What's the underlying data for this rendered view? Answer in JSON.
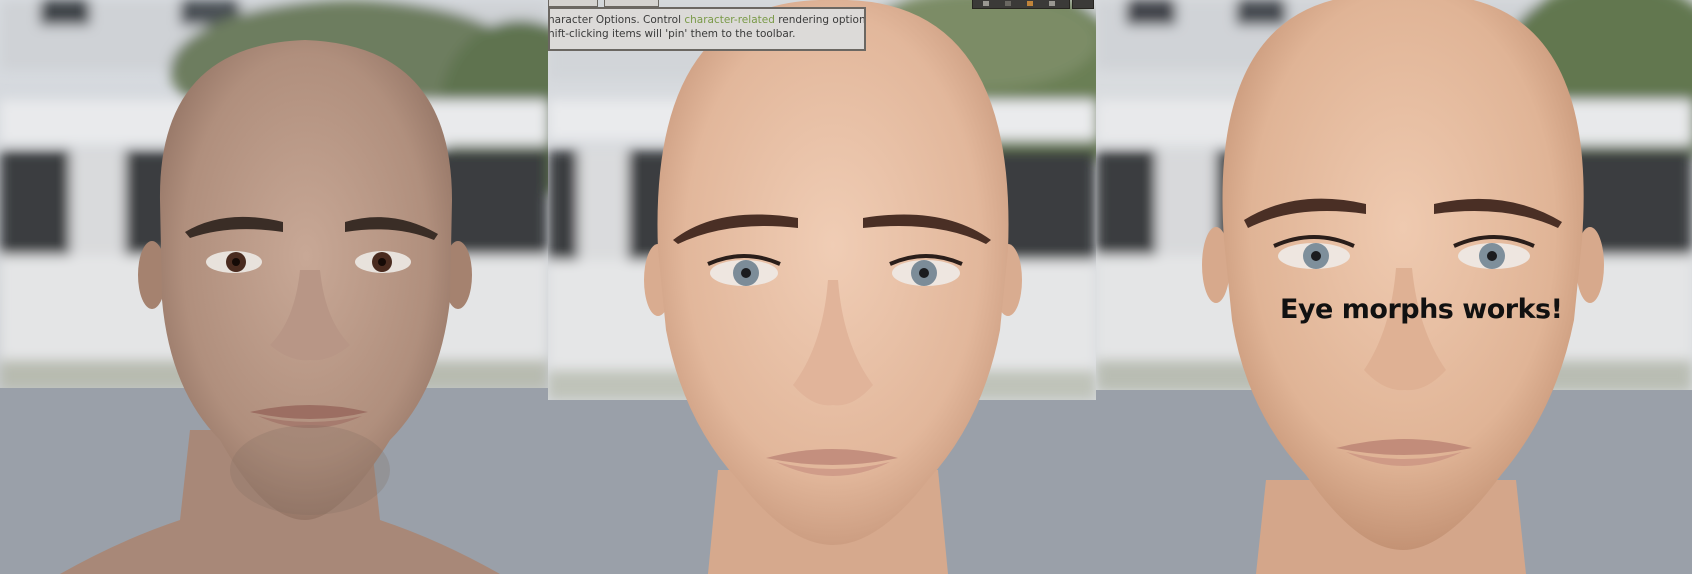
{
  "tooltip": {
    "line1_prefix": "haracter Options.  Control ",
    "line1_highlight": "character-related",
    "line1_suffix": " rendering options.",
    "line2": "hift-clicking items will 'pin' them to the toolbar."
  },
  "caption": "Eye morphs works!",
  "colors": {
    "floor": "#9aa0a9",
    "building": "#e2e3e5",
    "foliage": "#6f8a58",
    "skin_male": "#b89886",
    "skin_female": "#e7c0a6",
    "tooltip_bg": "#dcdad8",
    "caption_text": "#111111"
  },
  "panels": [
    {
      "name": "male-head-render",
      "eye_color": "brown"
    },
    {
      "name": "female-head-render-before",
      "eye_color": "blue-grey"
    },
    {
      "name": "female-head-render-after",
      "eye_color": "blue-grey"
    }
  ]
}
